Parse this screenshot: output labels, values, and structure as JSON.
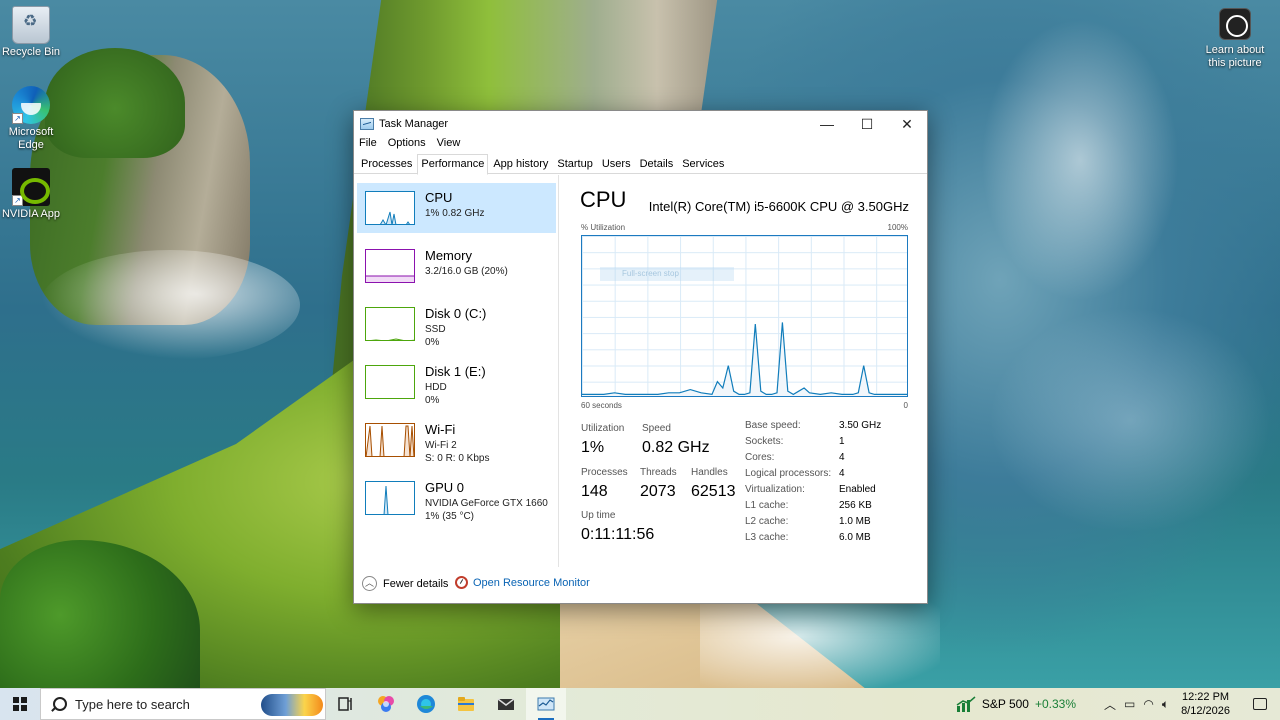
{
  "desktop": {
    "icons": [
      {
        "label": "Recycle Bin"
      },
      {
        "label": "Microsoft Edge"
      },
      {
        "label": "NVIDIA App"
      }
    ],
    "learn_about": "Learn about this picture"
  },
  "window": {
    "title": "Task Manager",
    "controls": {
      "minimize": "—",
      "maximize": "☐",
      "close": "✕"
    },
    "menu": [
      "File",
      "Options",
      "View"
    ],
    "tabs": [
      "Processes",
      "Performance",
      "App history",
      "Startup",
      "Users",
      "Details",
      "Services"
    ],
    "active_tab": "Performance"
  },
  "sidebar": {
    "resources": [
      {
        "name": "CPU",
        "line1": "1% 0.82 GHz",
        "line2": "",
        "color": "#117dbb",
        "selected": true
      },
      {
        "name": "Memory",
        "line1": "3.2/16.0 GB (20%)",
        "line2": "",
        "color": "#8b12ae"
      },
      {
        "name": "Disk 0 (C:)",
        "line1": "SSD",
        "line2": "0%",
        "color": "#4da60c"
      },
      {
        "name": "Disk 1 (E:)",
        "line1": "HDD",
        "line2": "0%",
        "color": "#4da60c"
      },
      {
        "name": "Wi-Fi",
        "line1": "Wi-Fi 2",
        "line2": "S: 0  R: 0 Kbps",
        "color": "#a74f01"
      },
      {
        "name": "GPU 0",
        "line1": "NVIDIA GeForce GTX 1660",
        "line2": "1%  (35 °C)",
        "color": "#117dbb"
      }
    ]
  },
  "cpu_panel": {
    "title": "CPU",
    "model": "Intel(R) Core(TM) i5-6600K CPU @ 3.50GHz",
    "util_label": "% Utilization",
    "util_max": "100%",
    "ghost_label": "Full-screen stop",
    "time_label": "60 seconds",
    "time_end": "0",
    "stats": {
      "utilization_label": "Utilization",
      "utilization": "1%",
      "speed_label": "Speed",
      "speed": "0.82 GHz",
      "processes_label": "Processes",
      "processes": "148",
      "threads_label": "Threads",
      "threads": "2073",
      "handles_label": "Handles",
      "handles": "62513",
      "uptime_label": "Up time",
      "uptime": "0:11:11:56"
    },
    "specs": [
      {
        "k": "Base speed:",
        "v": "3.50 GHz"
      },
      {
        "k": "Sockets:",
        "v": "1"
      },
      {
        "k": "Cores:",
        "v": "4"
      },
      {
        "k": "Logical processors:",
        "v": "4"
      },
      {
        "k": "Virtualization:",
        "v": "Enabled"
      },
      {
        "k": "L1 cache:",
        "v": "256 KB"
      },
      {
        "k": "L2 cache:",
        "v": "1.0 MB"
      },
      {
        "k": "L3 cache:",
        "v": "6.0 MB"
      }
    ]
  },
  "chart_data": {
    "type": "area",
    "title": "",
    "xlabel": "",
    "ylabel": "% Utilization",
    "xlim": [
      60,
      0
    ],
    "ylim": [
      0,
      100
    ],
    "x": [
      60,
      58,
      56,
      54,
      52,
      50,
      48,
      46,
      44,
      42,
      40,
      38,
      36,
      35,
      34,
      33,
      32,
      31,
      30,
      29,
      28,
      27,
      26,
      25,
      24,
      23,
      22,
      21,
      20,
      19,
      18,
      16,
      14,
      12,
      10,
      9,
      8,
      7,
      6,
      5,
      4,
      2,
      0
    ],
    "series": [
      {
        "values": [
          1,
          1,
          1,
          2,
          1,
          1,
          1,
          1,
          2,
          2,
          4,
          2,
          1,
          9,
          5,
          19,
          3,
          1,
          1,
          2,
          45,
          3,
          1,
          1,
          2,
          46,
          3,
          1,
          3,
          5,
          2,
          1,
          2,
          1,
          1,
          2,
          19,
          2,
          1,
          1,
          1,
          1,
          1
        ]
      }
    ],
    "grid": true
  },
  "footer": {
    "fewer": "Fewer details",
    "resmon": "Open Resource Monitor"
  },
  "taskbar": {
    "search_placeholder": "Type here to search",
    "stock_name": "S&P 500",
    "stock_change": "+0.33%",
    "time": "12:22 PM",
    "date": "8/12/2026"
  }
}
